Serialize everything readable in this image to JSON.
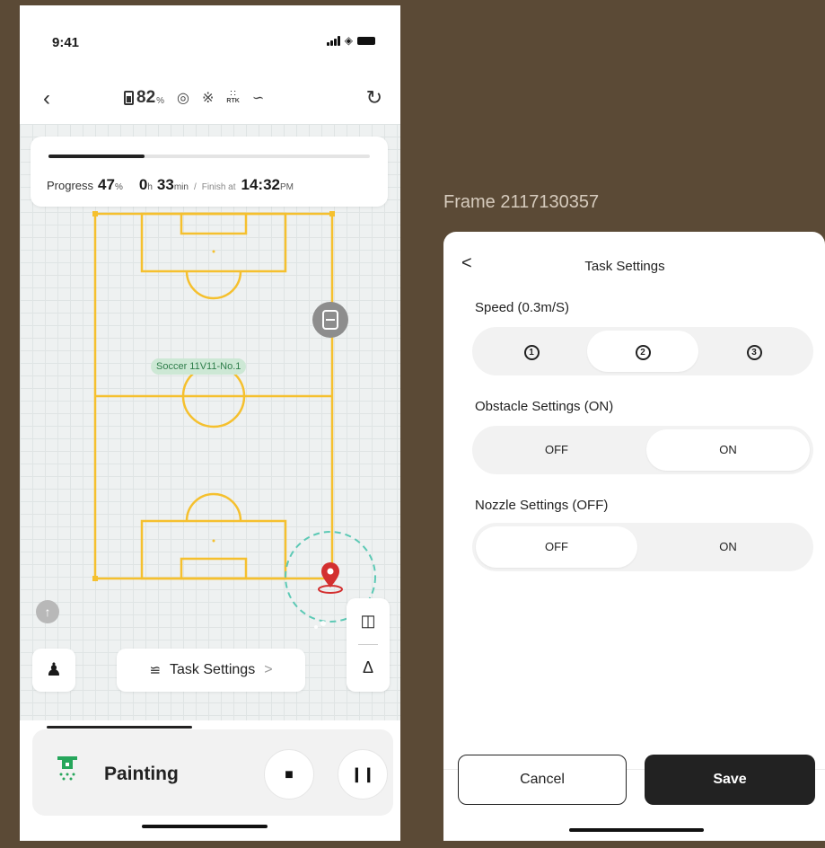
{
  "colors": {
    "background": "#5b4a36",
    "field_line": "#f5c02e",
    "accent_dark": "#222222",
    "marker_red": "#d32f2f",
    "range_circle": "#5cc9b5",
    "label_green": "#2e7d4a"
  },
  "status_bar": {
    "time": "9:41"
  },
  "top_bar": {
    "battery_value": "82",
    "battery_unit": "%",
    "rtk_label": "RTK",
    "icons": [
      "back-icon",
      "battery-icon",
      "gps-icon",
      "bluetooth-icon",
      "rtk-icon",
      "signal-icon",
      "refresh-icon"
    ]
  },
  "progress": {
    "label": "Progress",
    "value": "47",
    "unit": "%",
    "fill_fraction": 0.3,
    "hours": "0",
    "hours_unit": "h",
    "minutes": "33",
    "minutes_unit": "min",
    "separator": "/",
    "finish_label": "Finish at",
    "finish_time": "14:32",
    "finish_ampm": "PM"
  },
  "map": {
    "field_name": "Soccer 11V11-No.1"
  },
  "controls": {
    "task_settings_label": "Task Settings",
    "task_settings_chevron": ">"
  },
  "bottom_bar": {
    "mode_label": "Painting"
  },
  "frame_label": "Frame 2117130357",
  "task_settings": {
    "back": "<",
    "title": "Task Settings",
    "speed": {
      "label": "Speed (0.3m/S)",
      "options": [
        "1",
        "2",
        "3"
      ],
      "selected_index": 1
    },
    "obstacle": {
      "label": "Obstacle Settings (ON)",
      "options": [
        "OFF",
        "ON"
      ],
      "selected": "ON"
    },
    "nozzle": {
      "label": "Nozzle Settings (OFF)",
      "options": [
        "OFF",
        "ON"
      ],
      "selected": "OFF"
    },
    "cancel_label": "Cancel",
    "save_label": "Save"
  }
}
